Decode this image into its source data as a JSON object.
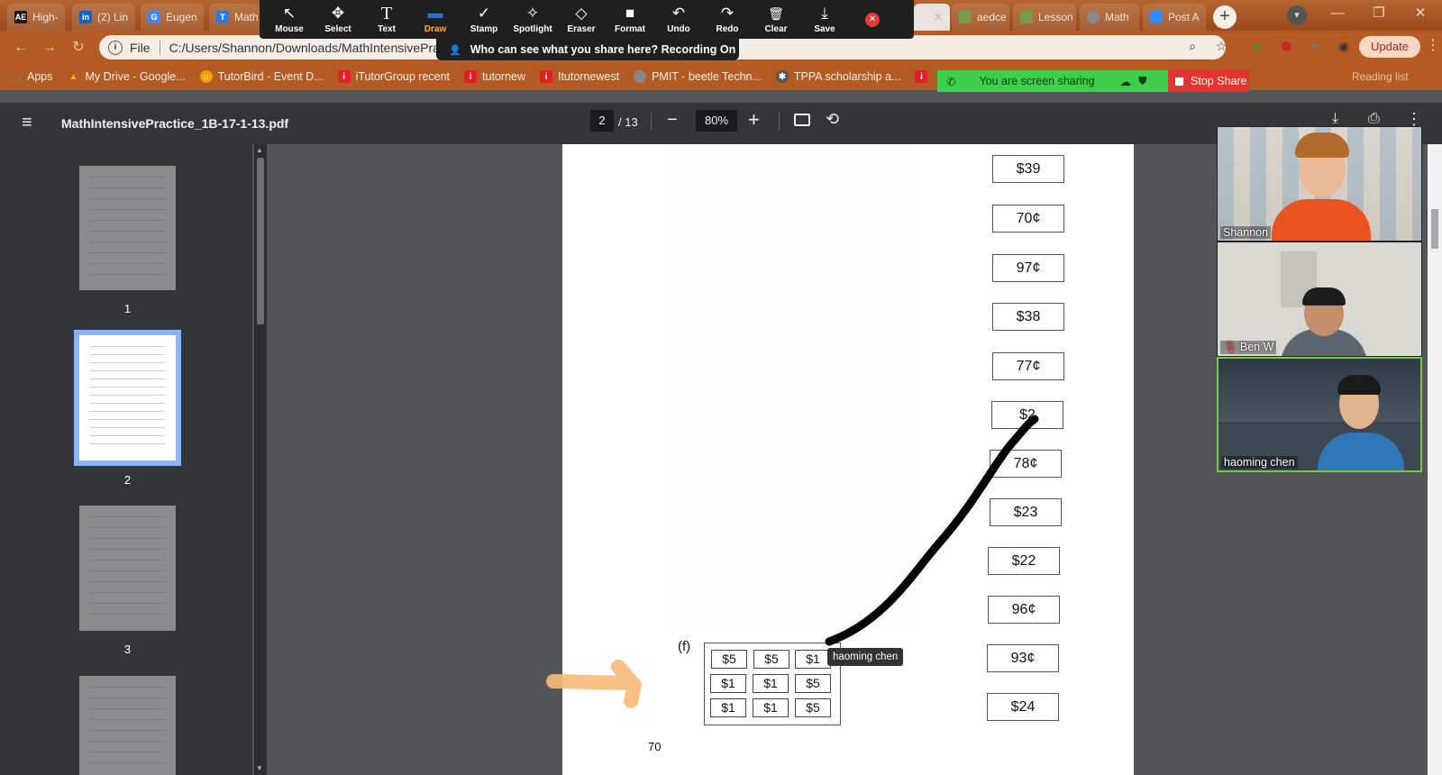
{
  "browser": {
    "tabs": [
      {
        "label": "High-",
        "icon_text": "AE",
        "icon_color": "#1a1a1a"
      },
      {
        "label": "(2) Lin",
        "icon_text": "in",
        "icon_color": "#0a66c2"
      },
      {
        "label": "Eugen",
        "icon_text": "G",
        "icon_color": "#4285f4"
      },
      {
        "label": "Math",
        "icon_text": "T",
        "icon_color": "#2c7be5"
      },
      {
        "label": "aedce",
        "icon_text": "",
        "icon_color": "#7a9a4a"
      },
      {
        "label": "Lesson",
        "icon_text": "",
        "icon_color": "#7a9a4a"
      },
      {
        "label": "Math",
        "icon_text": "",
        "icon_color": "#888888"
      },
      {
        "label": "Post A",
        "icon_text": "",
        "icon_color": "#2d8cff"
      }
    ],
    "address": {
      "scheme": "File",
      "url": "C:/Users/Shannon/Downloads/MathIntensivePrac"
    },
    "update_label": "Update",
    "reading_list": "Reading list",
    "bookmarks": [
      {
        "label": "Apps",
        "icon_color": "#4285f4"
      },
      {
        "label": "My Drive - Google...",
        "icon_color": "#f4b400"
      },
      {
        "label": "TutorBird - Event D...",
        "icon_color": "#f29f05"
      },
      {
        "label": "iTutorGroup recent",
        "icon_color": "#e31e24"
      },
      {
        "label": "tutornew",
        "icon_color": "#e31e24"
      },
      {
        "label": "Itutornewest",
        "icon_color": "#e31e24"
      },
      {
        "label": "PMIT - beetle Techn...",
        "icon_color": "#888888"
      },
      {
        "label": "TPPA scholarship a...",
        "icon_color": "#555555"
      }
    ]
  },
  "zoom": {
    "tools": [
      {
        "label": "Mouse",
        "icon": "↖"
      },
      {
        "label": "Select",
        "icon": "✥"
      },
      {
        "label": "Text",
        "icon": "T"
      },
      {
        "label": "Draw",
        "icon": "▬"
      },
      {
        "label": "Stamp",
        "icon": "✓"
      },
      {
        "label": "Spotlight",
        "icon": "✧"
      },
      {
        "label": "Eraser",
        "icon": "◇"
      },
      {
        "label": "Format",
        "icon": "■"
      },
      {
        "label": "Undo",
        "icon": "↶"
      },
      {
        "label": "Redo",
        "icon": "↷"
      },
      {
        "label": "Clear",
        "icon": "🗑"
      },
      {
        "label": "Save",
        "icon": "⤓"
      }
    ],
    "active_tool": "Draw",
    "share_notice": "Who can see what you share here? Recording On",
    "sharing_status": "You are screen sharing",
    "stop_share_label": "Stop Share",
    "participants": [
      {
        "name": "Shannon",
        "muted": false
      },
      {
        "name": "Ben W",
        "muted": true
      },
      {
        "name": "haoming   chen",
        "muted": false
      }
    ],
    "annotator_name": "haoming   chen"
  },
  "pdf": {
    "title": "MathIntensivePractice_1B-17-1-13.pdf",
    "current_page": "2",
    "total_pages": "/ 13",
    "zoom": "80%",
    "thumbnails": [
      "1",
      "2",
      "3"
    ],
    "selected_thumbnail": "2",
    "prices": [
      "$39",
      "70¢",
      "97¢",
      "$38",
      "77¢",
      "$2",
      "78¢",
      "$23",
      "$22",
      "96¢",
      "93¢",
      "$24"
    ],
    "question_label": "(f)",
    "bills": [
      [
        "$5",
        "$5",
        "$1"
      ],
      [
        "$1",
        "$1",
        "$5"
      ],
      [
        "$1",
        "$1",
        "$5"
      ]
    ],
    "page_number": "70"
  },
  "colors": {
    "tabstrip": "#b45a23",
    "zoom_toolbar": "#1f1f1f",
    "draw_accent": "#ffb02e",
    "sharing_green": "#3ecf4a",
    "stop_red": "#e3342f",
    "annotation_black": "#000000",
    "annotation_orange": "#f7b977"
  }
}
